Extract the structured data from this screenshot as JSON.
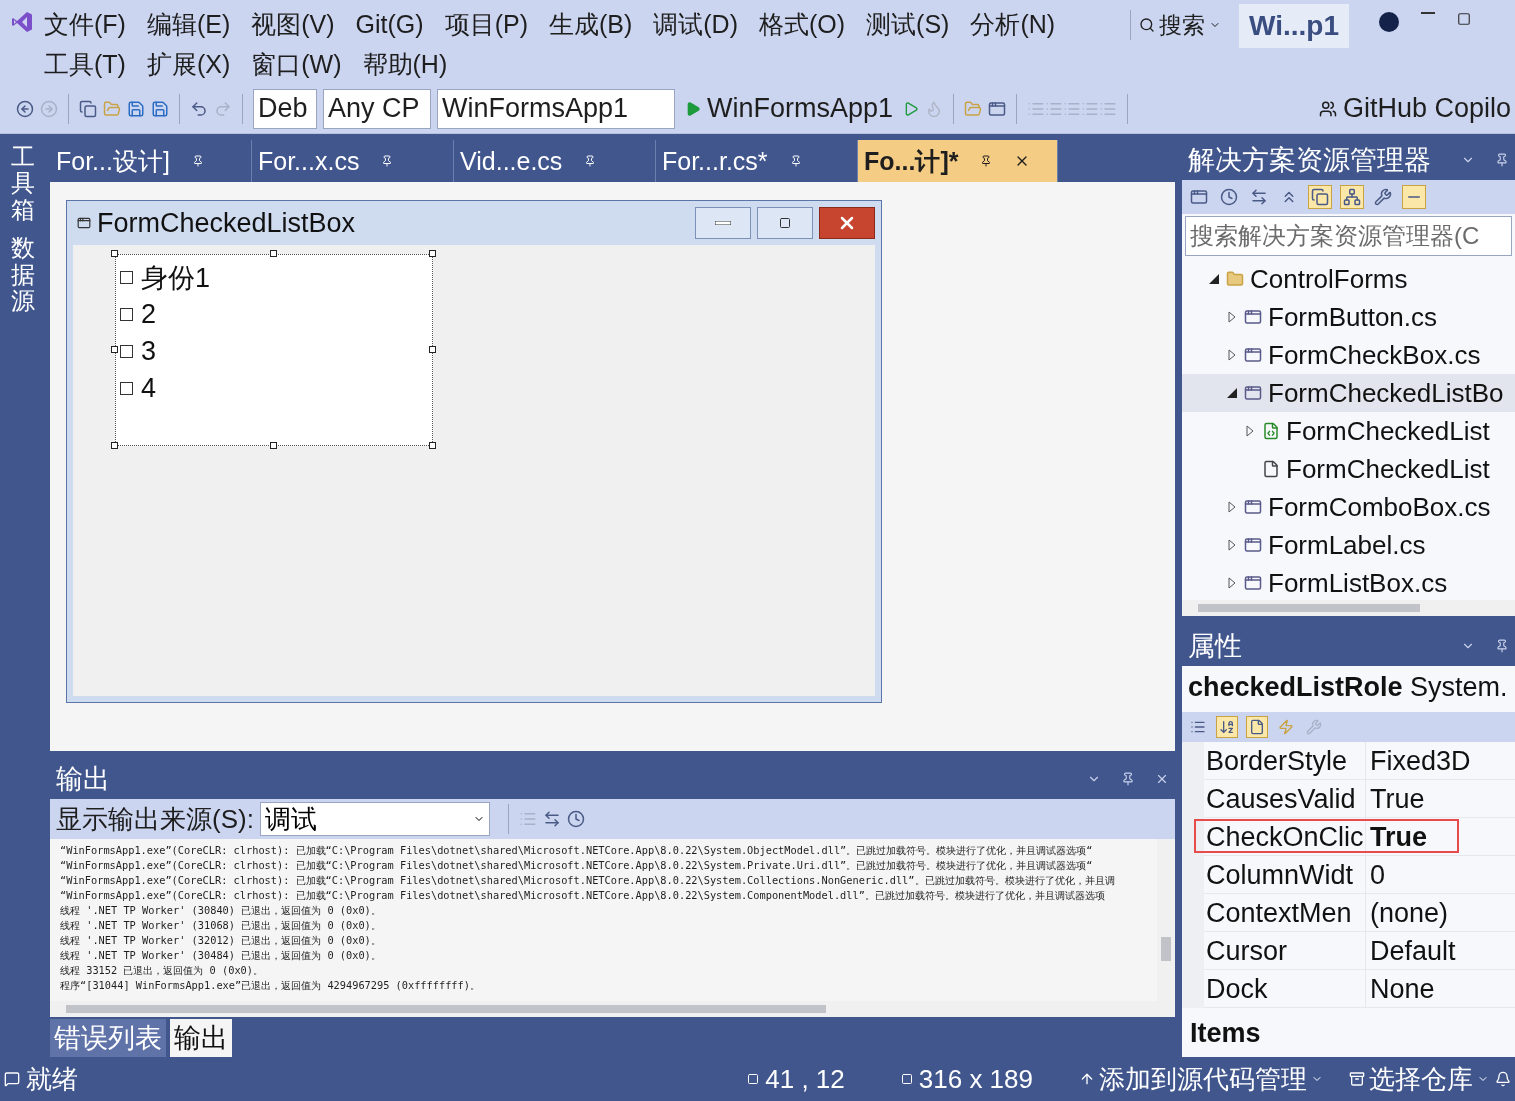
{
  "menu_rows": [
    [
      "文件(F)",
      "编辑(E)",
      "视图(V)",
      "Git(G)",
      "项目(P)",
      "生成(B)",
      "调试(D)",
      "格式(O)",
      "测试(S)",
      "分析(N)"
    ],
    [
      "工具(T)",
      "扩展(X)",
      "窗口(W)",
      "帮助(H)"
    ]
  ],
  "search": {
    "label": "搜索"
  },
  "solution_badge": "Wi...p1",
  "toolbar": {
    "configuration": "Deb",
    "platform": "Any CP",
    "startup_project": "WinFormsApp1",
    "run_label": "WinFormsApp1",
    "copilot": "GitHub Copilo"
  },
  "side_tabs": [
    "工具箱",
    "数据源"
  ],
  "document_tabs": [
    {
      "label": "For...设计]",
      "selected": false
    },
    {
      "label": "For...x.cs",
      "selected": false
    },
    {
      "label": "Vid...e.cs",
      "selected": false
    },
    {
      "label": "For...r.cs*",
      "selected": false
    },
    {
      "label": "Fo...计]*",
      "selected": true
    }
  ],
  "designer": {
    "form_title": "FormCheckedListBox",
    "items": [
      {
        "label": "身份1",
        "checked": false
      },
      {
        "label": "2",
        "checked": false
      },
      {
        "label": "3",
        "checked": false
      },
      {
        "label": "4",
        "checked": false
      }
    ]
  },
  "output": {
    "title": "输出",
    "source_label": "显示输出来源(S):",
    "source": "调试",
    "lines": [
      "“WinFormsApp1.exe”(CoreCLR: clrhost): 已加载“C:\\Program Files\\dotnet\\shared\\Microsoft.NETCore.App\\8.0.22\\System.ObjectModel.dll”。已跳过加载符号。模块进行了优化，并且调试器选项“",
      "“WinFormsApp1.exe”(CoreCLR: clrhost): 已加载“C:\\Program Files\\dotnet\\shared\\Microsoft.NETCore.App\\8.0.22\\System.Private.Uri.dll”。已跳过加载符号。模块进行了优化，并且调试器选项“",
      "“WinFormsApp1.exe”(CoreCLR: clrhost): 已加载“C:\\Program Files\\dotnet\\shared\\Microsoft.NETCore.App\\8.0.22\\System.Collections.NonGeneric.dll”。已跳过加载符号。模块进行了优化，并且调",
      "“WinFormsApp1.exe”(CoreCLR: clrhost): 已加载“C:\\Program Files\\dotnet\\shared\\Microsoft.NETCore.App\\8.0.22\\System.ComponentModel.dll”。已跳过加载符号。模块进行了优化，并且调试器选项",
      "线程 '.NET TP Worker' (30840) 已退出，返回值为 0 (0x0)。",
      "线程 '.NET TP Worker' (31068) 已退出，返回值为 0 (0x0)。",
      "线程 '.NET TP Worker' (32012) 已退出，返回值为 0 (0x0)。",
      "线程 '.NET TP Worker' (30484) 已退出，返回值为 0 (0x0)。",
      "线程 33152 已退出，返回值为 0 (0x0)。",
      "程序“[31044] WinFormsApp1.exe”已退出，返回值为 4294967295 (0xffffffff)。"
    ],
    "tabs": [
      {
        "label": "错误列表",
        "selected": false
      },
      {
        "label": "输出",
        "selected": true
      }
    ]
  },
  "solution_explorer": {
    "title": "解决方案资源管理器",
    "search_placeholder": "搜索解决方案资源管理器(C",
    "tree": [
      {
        "label": "ControlForms",
        "kind": "folder",
        "expanded": true,
        "selected": false,
        "children": [
          {
            "label": "FormButton.cs",
            "kind": "form",
            "expanded": false,
            "selected": false
          },
          {
            "label": "FormCheckBox.cs",
            "kind": "form",
            "expanded": false,
            "selected": false
          },
          {
            "label": "FormCheckedListBo",
            "kind": "form",
            "expanded": true,
            "selected": true,
            "children": [
              {
                "label": "FormCheckedList",
                "kind": "csharp",
                "expanded": false,
                "selected": false
              },
              {
                "label": "FormCheckedList",
                "kind": "resource",
                "selected": false
              }
            ]
          },
          {
            "label": "FormComboBox.cs",
            "kind": "form",
            "expanded": false,
            "selected": false
          },
          {
            "label": "FormLabel.cs",
            "kind": "form",
            "expanded": false,
            "selected": false
          },
          {
            "label": "FormListBox.cs",
            "kind": "form",
            "expanded": false,
            "selected": false
          }
        ]
      }
    ]
  },
  "properties": {
    "title": "属性",
    "object": "**checkedListRole** System.",
    "rows": [
      {
        "name": "BorderStyle",
        "value": "Fixed3D",
        "modified": false,
        "highlighted": false
      },
      {
        "name": "CausesValid",
        "value": "True",
        "modified": false,
        "highlighted": false
      },
      {
        "name": "CheckOnClic",
        "value": "True",
        "modified": true,
        "highlighted": true
      },
      {
        "name": "ColumnWidt",
        "value": "0",
        "modified": false,
        "highlighted": false
      },
      {
        "name": "ContextMen",
        "value": "(none)",
        "modified": false,
        "highlighted": false
      },
      {
        "name": "Cursor",
        "value": "Default",
        "modified": false,
        "highlighted": false
      },
      {
        "name": "Dock",
        "value": "None",
        "modified": false,
        "highlighted": false
      }
    ],
    "description_title": "Items"
  },
  "status_bar": {
    "state": "就绪",
    "position": "41 , 12",
    "size": "316 x 189",
    "source_control": "添加到源代码管理",
    "repository": "选择仓库"
  }
}
